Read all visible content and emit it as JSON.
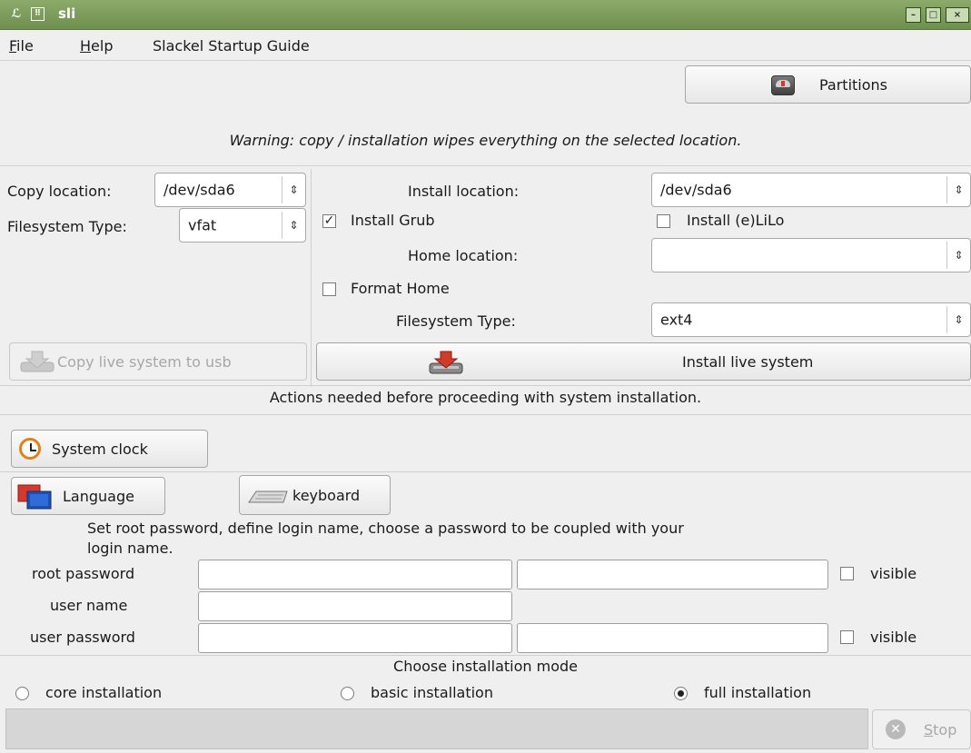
{
  "window": {
    "title": "sli",
    "controls": {
      "minimize": "–",
      "maximize": "□",
      "close": "×"
    }
  },
  "menu": [
    {
      "underline": "F",
      "rest": "ile"
    },
    {
      "underline": "H",
      "rest": "elp"
    },
    {
      "underline": "",
      "rest": "Slackel Startup Guide"
    }
  ],
  "partitions_button": {
    "label": "Partitions",
    "icon": "disk-icon"
  },
  "warning": "Warning: copy / installation wipes everything on the selected location.",
  "copy": {
    "location_label": "Copy location:",
    "location_value": "/dev/sda6",
    "fs_label": "Filesystem Type:",
    "fs_value": "vfat",
    "copy_button": "Copy live system to usb"
  },
  "install": {
    "location_label": "Install location:",
    "location_value": "/dev/sda6",
    "grub_label": "Install Grub",
    "grub_checked": true,
    "lilo_label": "Install (e)LiLo",
    "lilo_checked": false,
    "home_label": "Home location:",
    "home_value": "",
    "format_home_label": "Format Home",
    "format_home_checked": false,
    "fs_label": "Filesystem Type:",
    "fs_value": "ext4",
    "install_button": "Install live system"
  },
  "actions_header": "Actions needed before proceeding with system installation.",
  "actions": {
    "clock": "System clock",
    "language": "Language",
    "keyboard": "keyboard"
  },
  "password": {
    "instructions_line1": "Set root password, define login name, choose a password to be coupled with your",
    "instructions_line2": "login name.",
    "root_label": "root password",
    "user_label": "user name",
    "user_password_label": "user password",
    "visible_label": "visible"
  },
  "mode": {
    "header": "Choose installation mode",
    "options": [
      {
        "label": "core installation",
        "selected": false
      },
      {
        "label": "basic installation",
        "selected": false
      },
      {
        "label": "full installation",
        "selected": true
      }
    ]
  },
  "stop_button": {
    "prefix": "S",
    "rest": "top"
  },
  "colors": {
    "titlebar": "#7d9c5c",
    "accent_red": "#d23a2a",
    "clock_orange": "#e0821c"
  }
}
